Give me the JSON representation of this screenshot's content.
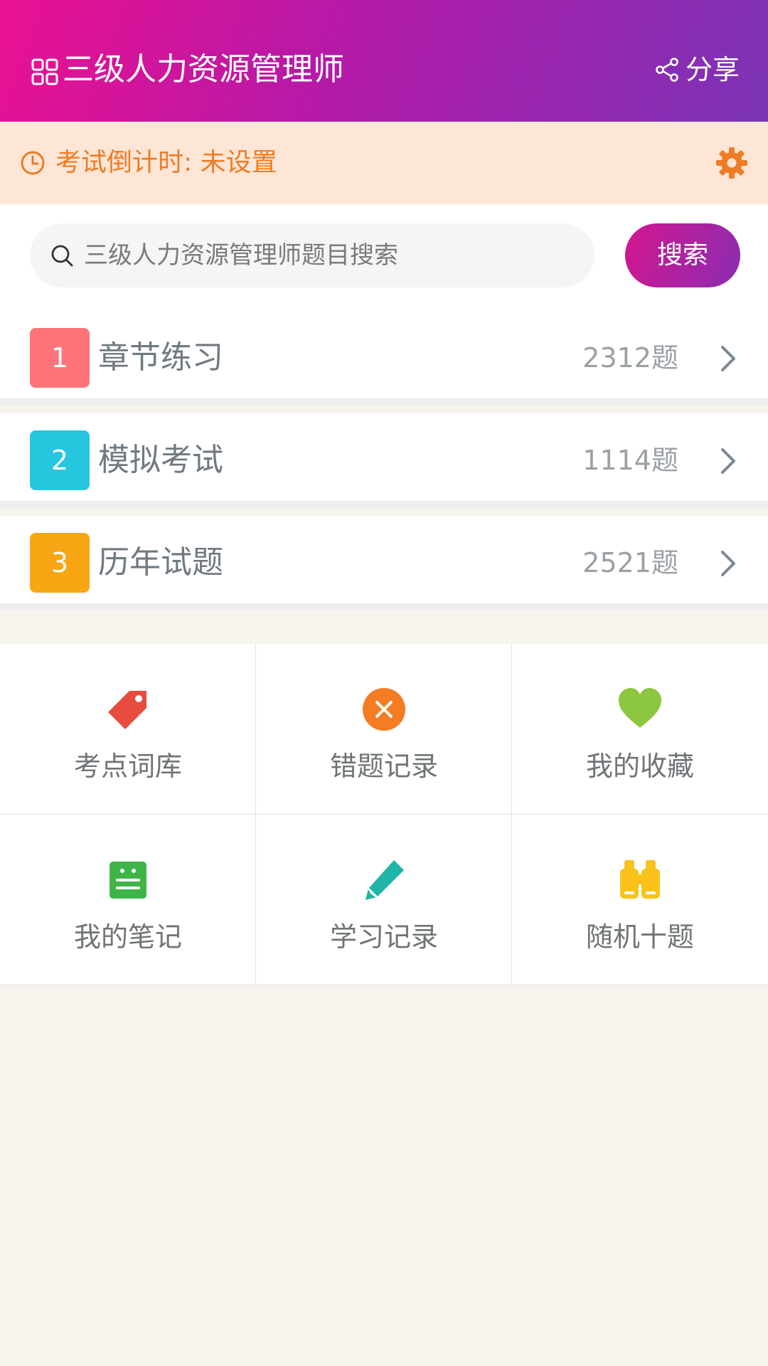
{
  "header": {
    "title": "三级人力资源管理师",
    "share_label": "分享",
    "menu_icon": "grid-icon",
    "share_icon": "share-icon"
  },
  "countdown": {
    "label": "考试倒计时: 未设置",
    "icon": "clock-icon",
    "settings_icon": "gear-icon"
  },
  "search": {
    "placeholder": "三级人力资源管理师题目搜索",
    "button_label": "搜索"
  },
  "list": [
    {
      "number": "1",
      "label": "章节练习",
      "count": "2312题",
      "color": "#fe7479"
    },
    {
      "number": "2",
      "label": "模拟考试",
      "count": "1114题",
      "color": "#26c6de"
    },
    {
      "number": "3",
      "label": "历年试题",
      "count": "2521题",
      "color": "#f8a614"
    }
  ],
  "tools": [
    {
      "label": "考点词库",
      "icon": "tag-icon",
      "color": "#e84c3d"
    },
    {
      "label": "错题记录",
      "icon": "close-circle-icon",
      "color": "#f47c22"
    },
    {
      "label": "我的收藏",
      "icon": "heart-icon",
      "color": "#8dc63f"
    },
    {
      "label": "我的笔记",
      "icon": "notepad-icon",
      "color": "#3fb548"
    },
    {
      "label": "学习记录",
      "icon": "pencil-icon",
      "color": "#1fb5a8"
    },
    {
      "label": "随机十题",
      "icon": "binoculars-icon",
      "color": "#f9c21a"
    }
  ],
  "colors": {
    "header_gradient": [
      "#ea1191",
      "#7b34b6"
    ],
    "countdown_bg": "#fee6d6",
    "countdown_text": "#ee7c24",
    "page_bg": "#f7f4ee"
  }
}
